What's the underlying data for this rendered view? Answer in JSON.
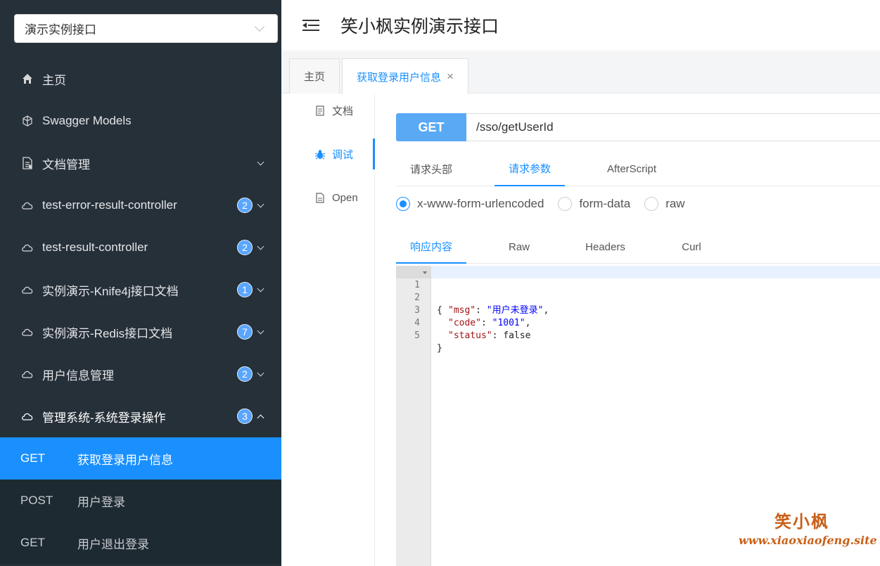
{
  "sidebar": {
    "group_select": "演示实例接口",
    "menu": [
      {
        "label": "主页",
        "icon": "home-icon"
      },
      {
        "label": "Swagger Models",
        "icon": "models-icon"
      },
      {
        "label": "文档管理",
        "icon": "doc-manage-icon",
        "expandable": true
      },
      {
        "label": "test-error-result-controller",
        "icon": "cloud-icon",
        "badge": "2"
      },
      {
        "label": "test-result-controller",
        "icon": "cloud-icon",
        "badge": "2"
      },
      {
        "label": "实例演示-Knife4j接口文档",
        "icon": "cloud-icon",
        "badge": "1"
      },
      {
        "label": "实例演示-Redis接口文档",
        "icon": "cloud-icon",
        "badge": "7"
      },
      {
        "label": "用户信息管理",
        "icon": "cloud-icon",
        "badge": "2"
      },
      {
        "label": "管理系统-系统登录操作",
        "icon": "cloud-icon",
        "badge": "3",
        "open": true
      }
    ],
    "submenu": [
      {
        "method": "GET",
        "label": "获取登录用户信息",
        "active": true
      },
      {
        "method": "POST",
        "label": "用户登录"
      },
      {
        "method": "GET",
        "label": "用户退出登录"
      }
    ]
  },
  "header": {
    "title": "笑小枫实例演示接口"
  },
  "tabs": [
    {
      "label": "主页"
    },
    {
      "label": "获取登录用户信息",
      "active": true,
      "close": "×"
    }
  ],
  "doc_nav": [
    {
      "label": "文档",
      "icon": "document-icon"
    },
    {
      "label": "调试",
      "icon": "bug-icon",
      "active": true
    },
    {
      "label": "Open",
      "icon": "file-icon"
    }
  ],
  "request": {
    "method": "GET",
    "url": "/sso/getUserId"
  },
  "param_tabs": [
    {
      "label": "请求头部"
    },
    {
      "label": "请求参数",
      "active": true
    },
    {
      "label": "AfterScript"
    }
  ],
  "body_types": [
    {
      "label": "x-www-form-urlencoded",
      "checked": true
    },
    {
      "label": "form-data"
    },
    {
      "label": "raw"
    }
  ],
  "response_tabs": [
    {
      "label": "响应内容",
      "active": true
    },
    {
      "label": "Raw"
    },
    {
      "label": "Headers"
    },
    {
      "label": "Curl"
    }
  ],
  "response": {
    "line_numbers": [
      "1",
      "2",
      "3",
      "4",
      "5"
    ],
    "open_brace": "{",
    "fields": [
      {
        "key": "\"msg\"",
        "value": "\"用户未登录\"",
        "comma": ","
      },
      {
        "key": "\"code\"",
        "value": "\"1001\"",
        "comma": ","
      },
      {
        "key": "\"status\"",
        "value": "false",
        "comma": ""
      }
    ],
    "close_brace": "}"
  },
  "watermark": {
    "line1": "笑小枫",
    "line2": "www.xiaoxiaofeng.site"
  },
  "colors": {
    "sidebar_bg": "#263039",
    "accent": "#1a90ff",
    "method_btn": "#5aa9f5"
  }
}
